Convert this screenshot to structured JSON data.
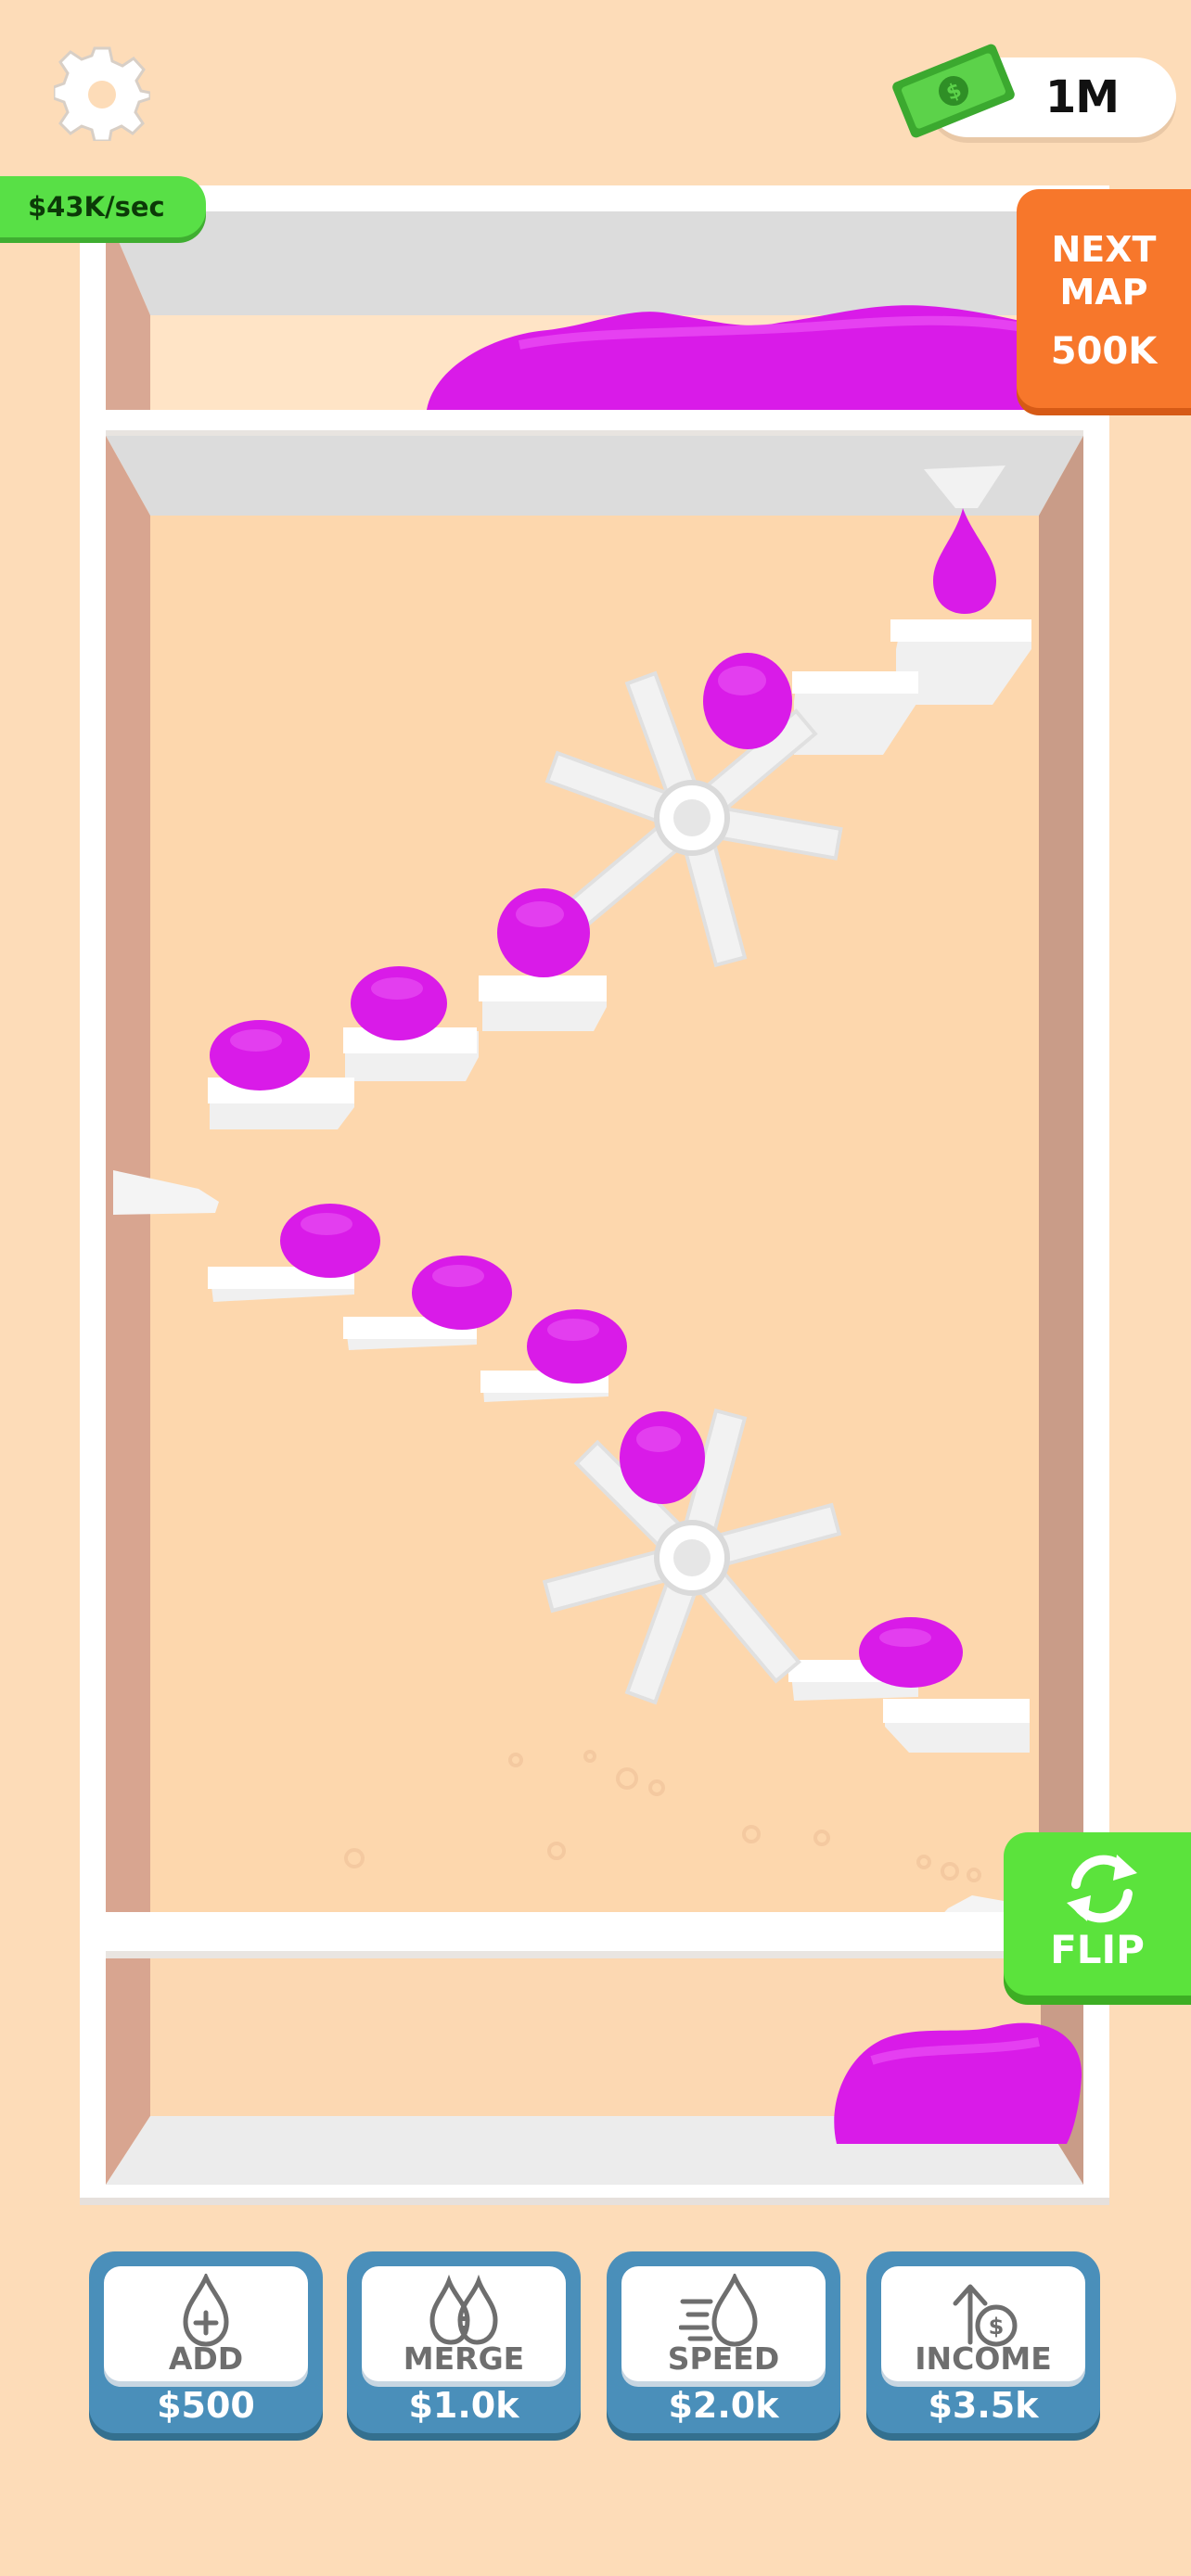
{
  "hud": {
    "money": "1M",
    "rate": "$43K/sec",
    "next_map": {
      "line1": "NEXT",
      "line2": "MAP",
      "cost": "500K"
    },
    "flip_label": "FLIP"
  },
  "upgrades": [
    {
      "name": "ADD",
      "price": "$500",
      "icon": "drop-plus-icon"
    },
    {
      "name": "MERGE",
      "price": "$1.0k",
      "icon": "double-drop-icon"
    },
    {
      "name": "SPEED",
      "price": "$2.0k",
      "icon": "speed-drop-icon"
    },
    {
      "name": "INCOME",
      "price": "$3.5k",
      "icon": "income-coin-icon"
    }
  ],
  "colors": {
    "background": "#fddcb8",
    "slime": "#d91be8",
    "money_green": "#58e046",
    "next_map_orange": "#f7772b",
    "upgrade_blue": "#4a8fba"
  }
}
